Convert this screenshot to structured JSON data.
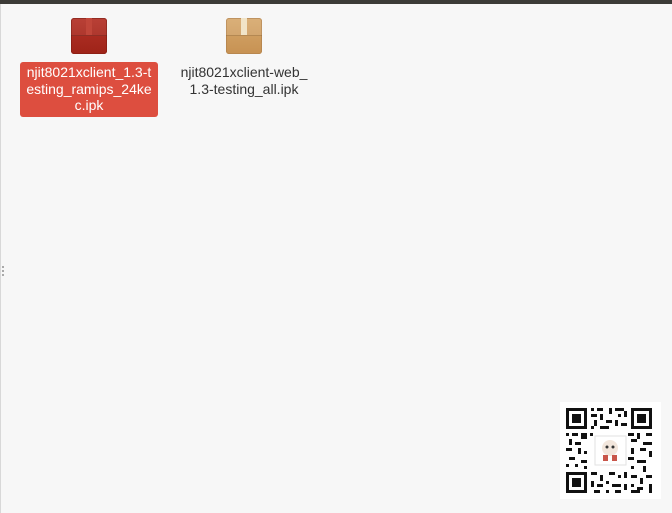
{
  "colors": {
    "background": "#f7f7f7",
    "selection": "#dd4e3f",
    "selected_icon": "#b5342a",
    "package_icon": "#d6a76a"
  },
  "files": [
    {
      "name": "njit8021xclient_1.3-testing_ramips_24kec.ipk",
      "icon": "package-icon",
      "selected": true
    },
    {
      "name": "njit8021xclient-web_1.3-testing_all.ipk",
      "icon": "package-icon",
      "selected": false
    }
  ],
  "qr_code": {
    "icon": "qr-code-icon"
  }
}
